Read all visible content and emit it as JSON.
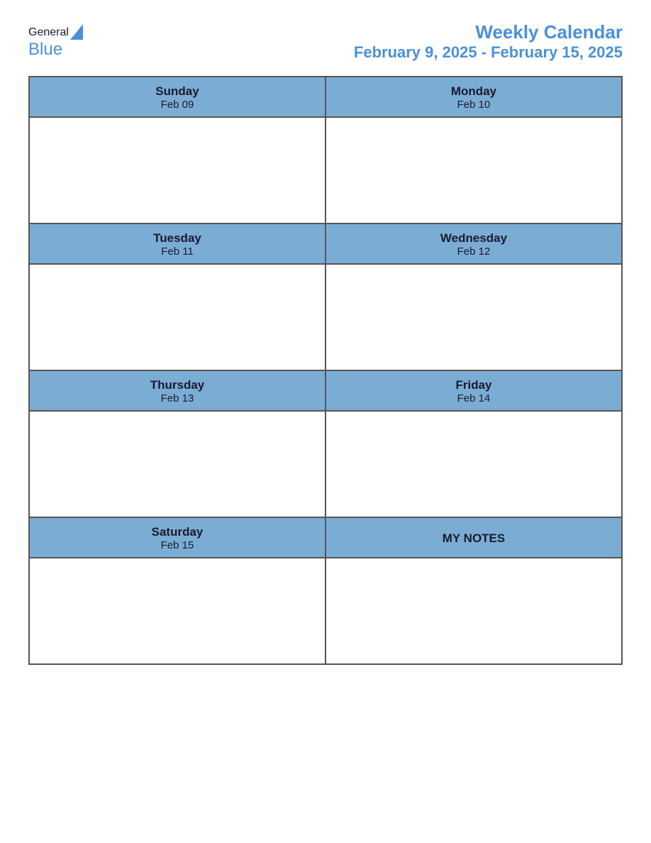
{
  "header": {
    "logo": {
      "general": "General",
      "blue": "Blue"
    },
    "title": "Weekly Calendar",
    "subtitle": "February 9, 2025 - February 15, 2025"
  },
  "calendar": {
    "rows": [
      {
        "cells": [
          {
            "day": "Sunday",
            "date": "Feb 09"
          },
          {
            "day": "Monday",
            "date": "Feb 10"
          }
        ]
      },
      {
        "cells": [
          {
            "day": "Tuesday",
            "date": "Feb 11"
          },
          {
            "day": "Wednesday",
            "date": "Feb 12"
          }
        ]
      },
      {
        "cells": [
          {
            "day": "Thursday",
            "date": "Feb 13"
          },
          {
            "day": "Friday",
            "date": "Feb 14"
          }
        ]
      },
      {
        "cells": [
          {
            "day": "Saturday",
            "date": "Feb 15"
          },
          {
            "day": "MY NOTES",
            "date": ""
          }
        ]
      }
    ]
  }
}
